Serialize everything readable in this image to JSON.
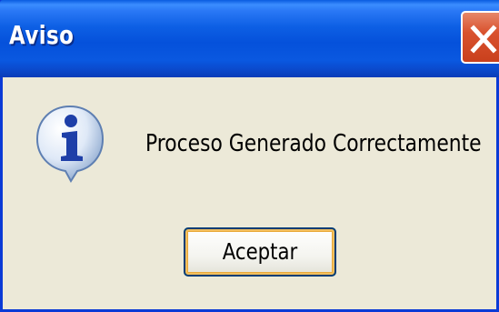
{
  "dialog": {
    "title": "Aviso",
    "message": "Proceso Generado Correctamente",
    "icon": "info-icon",
    "buttons": {
      "ok_label": "Aceptar",
      "close_icon": "close-icon"
    }
  },
  "colors": {
    "titlebar": "#0551db",
    "border": "#0b3ad6",
    "body": "#ece9d8",
    "close_button": "#d9522e",
    "button_focus": "#f2be5e"
  }
}
